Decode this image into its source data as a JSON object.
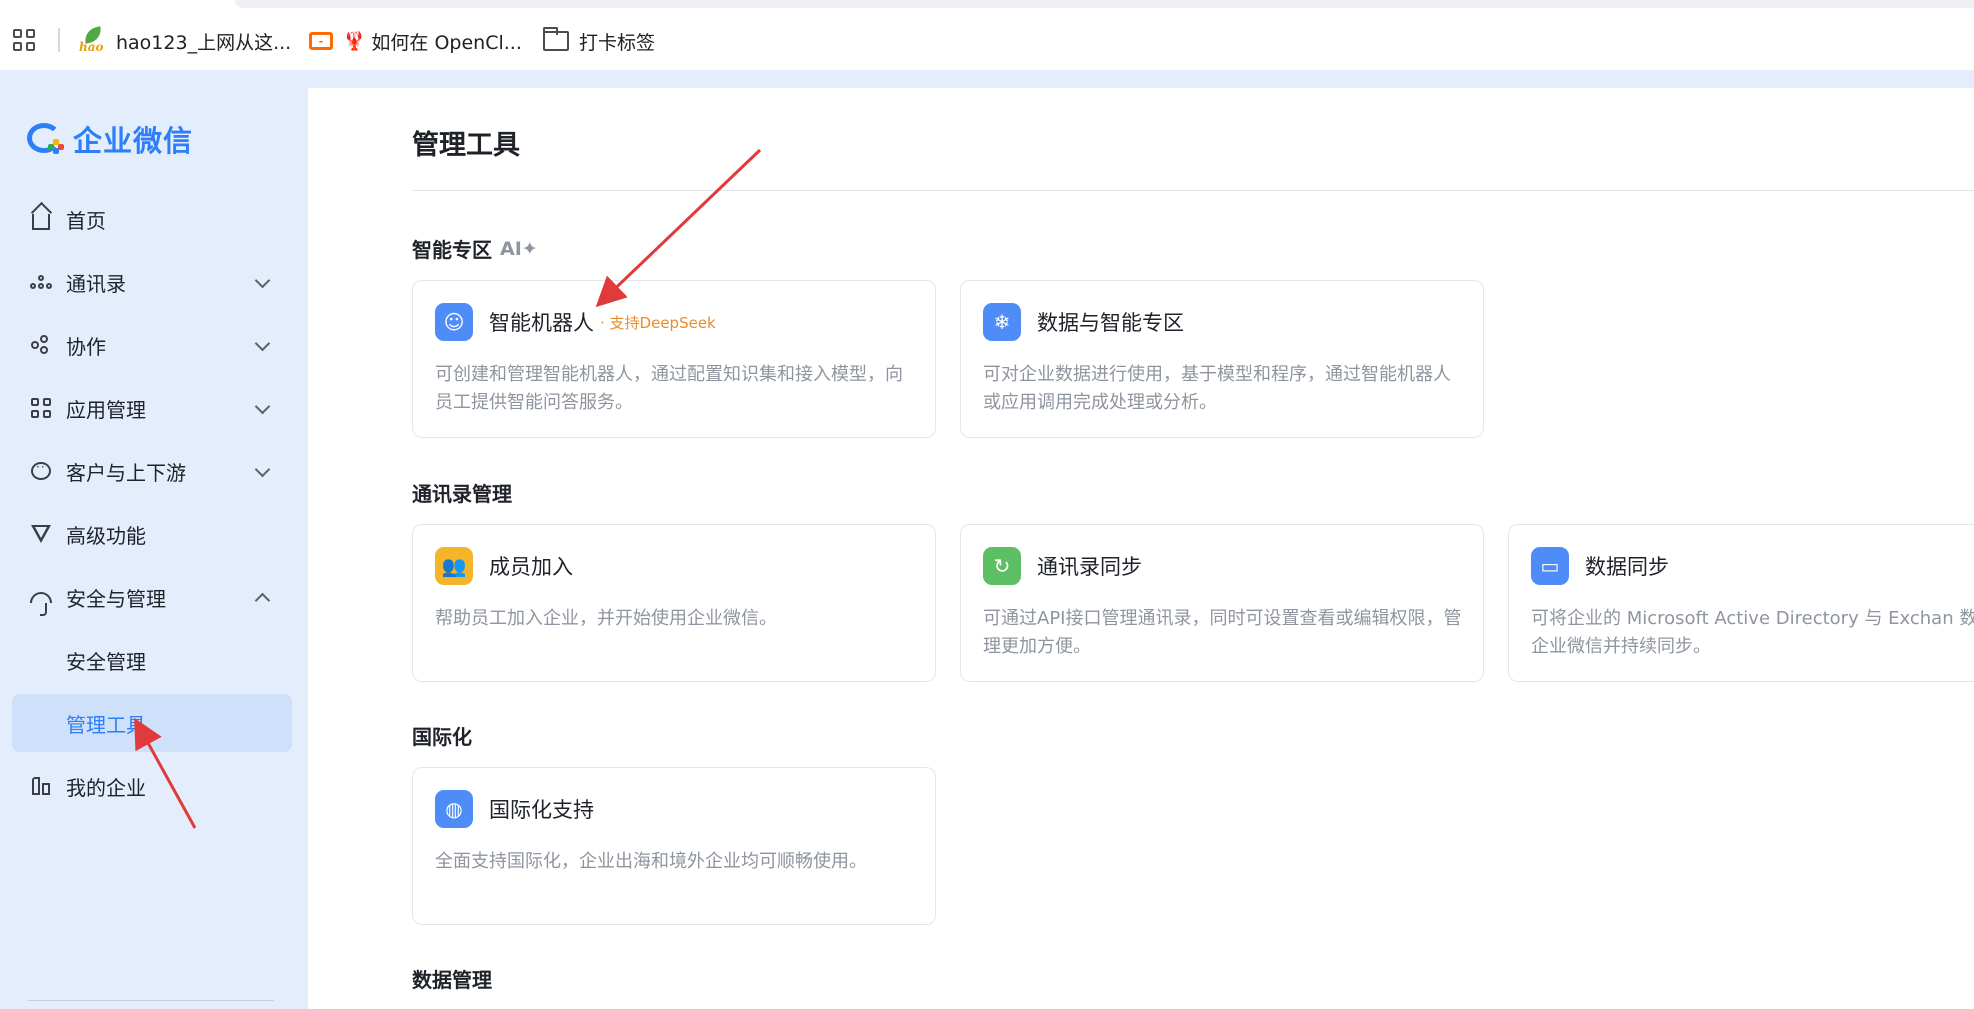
{
  "bookmarks": {
    "items": [
      {
        "label": "hao123_上网从这...",
        "icon": "hao123-logo-icon"
      },
      {
        "label": "如何在 OpenCl...",
        "icon": "opencloud-icon"
      },
      {
        "label": "打卡标签",
        "icon": "folder-icon"
      }
    ]
  },
  "sidebar": {
    "logo_text": "企业微信",
    "items": [
      {
        "label": "首页",
        "icon": "home-icon",
        "expandable": false
      },
      {
        "label": "通讯录",
        "icon": "org-chart-icon",
        "expandable": true
      },
      {
        "label": "协作",
        "icon": "collab-icon",
        "expandable": true
      },
      {
        "label": "应用管理",
        "icon": "grid-icon",
        "expandable": true
      },
      {
        "label": "客户与上下游",
        "icon": "chat-icon",
        "expandable": true
      },
      {
        "label": "高级功能",
        "icon": "triangle-icon",
        "expandable": false
      },
      {
        "label": "安全与管理",
        "icon": "umbrella-icon",
        "expandable": true,
        "expanded": true
      },
      {
        "label": "安全管理",
        "sub": true
      },
      {
        "label": "管理工具",
        "sub": true,
        "active": true
      },
      {
        "label": "我的企业",
        "icon": "building-icon",
        "expandable": false
      }
    ]
  },
  "main": {
    "title": "管理工具",
    "sections": [
      {
        "title": "智能专区",
        "tag": "AI✦",
        "cards": [
          {
            "title": "智能机器人",
            "tag": "· 支持DeepSeek",
            "desc": "可创建和管理智能机器人，通过配置知识集和接入模型，向员工提供智能问答服务。",
            "icon": "robot-icon",
            "color": "#4e8cf7"
          },
          {
            "title": "数据与智能专区",
            "desc": "可对企业数据进行使用，基于模型和程序，通过智能机器人或应用调用完成处理或分析。",
            "icon": "data-intel-icon",
            "color": "#4e8cf7"
          }
        ]
      },
      {
        "title": "通讯录管理",
        "cards": [
          {
            "title": "成员加入",
            "desc": "帮助员工加入企业，并开始使用企业微信。",
            "icon": "members-join-icon",
            "color": "#f3b62b"
          },
          {
            "title": "通讯录同步",
            "desc": "可通过API接口管理通讯录，同时可设置查看或编辑权限，管理更加方便。",
            "icon": "sync-icon",
            "color": "#5cbf63"
          },
          {
            "title": "数据同步",
            "desc": "可将企业的 Microsoft Active Directory 与 Exchan 数据导入至企业微信并持续同步。",
            "icon": "folder-sync-icon",
            "color": "#4e8cf7"
          }
        ]
      },
      {
        "title": "国际化",
        "cards": [
          {
            "title": "国际化支持",
            "desc": "全面支持国际化，企业出海和境外企业均可顺畅使用。",
            "icon": "globe-icon",
            "color": "#4e8cf7"
          }
        ]
      },
      {
        "title": "数据管理",
        "cards": []
      }
    ]
  },
  "colors": {
    "accent": "#2d7ff9",
    "sidebar_bg": "#e4edfb",
    "active_bg": "#cfe0fb",
    "annotation_arrow": "#e03a3a"
  }
}
